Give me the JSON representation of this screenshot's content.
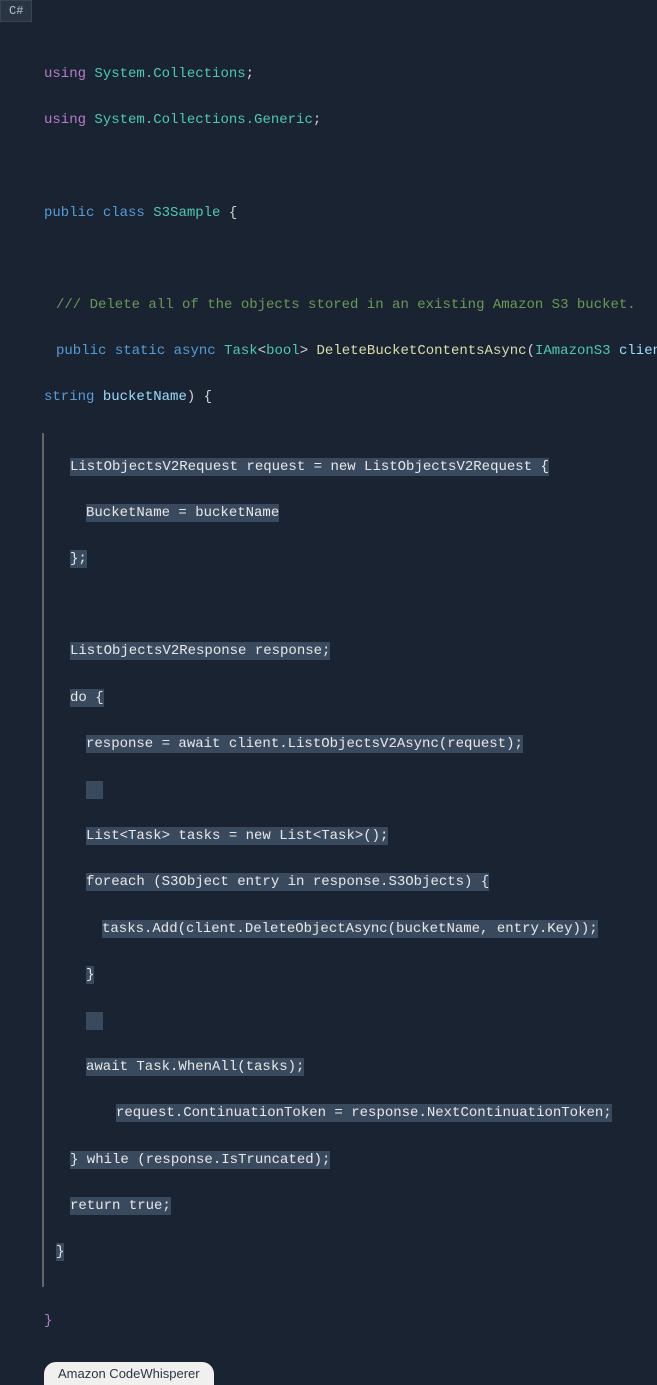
{
  "tab": {
    "label": "C#"
  },
  "code": {
    "using1_kw": "using",
    "using1_ns": "System.Collections",
    "using2_kw": "using",
    "using2_ns": "System.Collections.Generic",
    "public": "public",
    "class": "class",
    "classname": "S3Sample",
    "comment": "/// Delete all of the objects stored in an existing Amazon S3 bucket.",
    "method_public": "public",
    "method_static": "static",
    "method_async": "async",
    "task": "Task",
    "bool": "bool",
    "methodname": "DeleteBucketContentsAsync",
    "param1_type": "IAmazonS3",
    "param1_name": "client",
    "param2_type": "string",
    "param2_name": "bucketName",
    "line1": "ListObjectsV2Request request = new ListObjectsV2Request {",
    "line2": "BucketName = bucketName",
    "line3": "};",
    "line4": "ListObjectsV2Response response;",
    "line5": "do {",
    "line6": "response = await client.ListObjectsV2Async(request);",
    "line7": "List<Task> tasks = new List<Task>();",
    "line8": "foreach (S3Object entry in response.S3Objects) {",
    "line9": "tasks.Add(client.DeleteObjectAsync(bucketName, entry.Key));",
    "line10": "}",
    "line11": "await Task.WhenAll(tasks);",
    "line12": "request.ContinuationToken = response.NextContinuationToken;",
    "line13": "} while (response.IsTruncated);",
    "line14": "return true;",
    "line15": "}",
    "close_brace": "}"
  },
  "badge": {
    "label": "Amazon CodeWhisperer"
  }
}
